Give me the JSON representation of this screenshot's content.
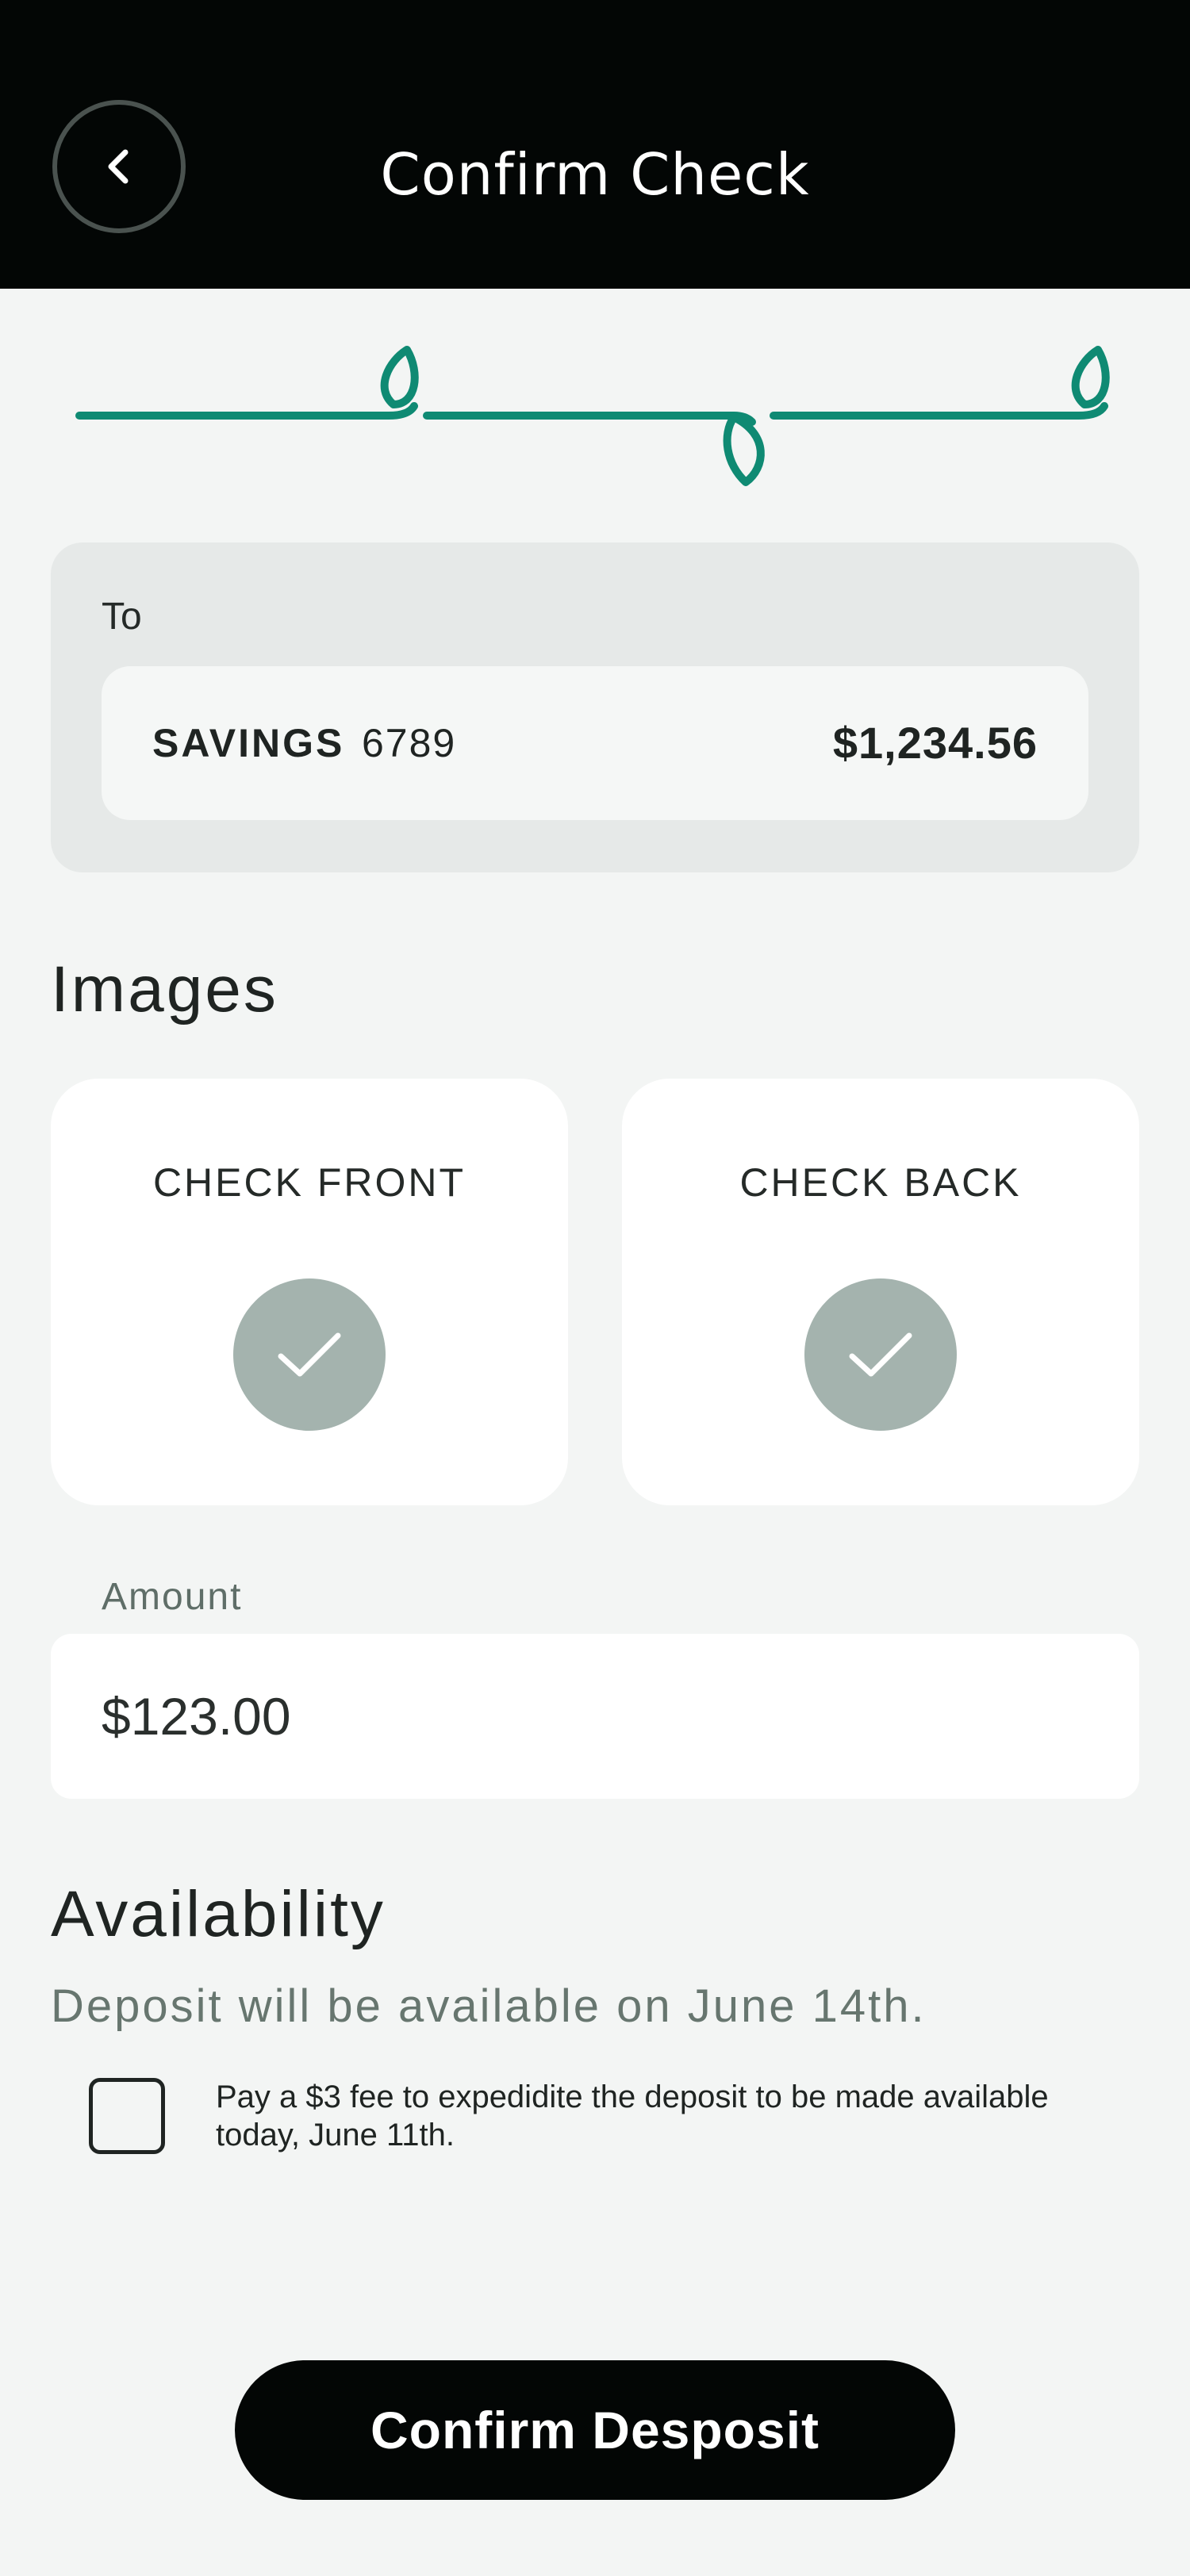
{
  "header": {
    "title": "Confirm Check",
    "back_icon": "chevron-left-icon"
  },
  "stepper": {
    "steps": 3,
    "accent_color": "#0f8a73"
  },
  "to_section": {
    "label": "To",
    "account": {
      "type": "SAVINGS",
      "number": "6789",
      "balance": "$1,234.56"
    }
  },
  "images_section": {
    "title": "Images",
    "cards": [
      {
        "label": "CHECK FRONT",
        "status_icon": "checkmark-icon"
      },
      {
        "label": "CHECK BACK",
        "status_icon": "checkmark-icon"
      }
    ]
  },
  "amount": {
    "label": "Amount",
    "value": "$123.00"
  },
  "availability": {
    "title": "Availability",
    "note": "Deposit will be available on June 14th.",
    "fee_option": {
      "checked": false,
      "text": "Pay a $3 fee to expedidite the deposit to be made available today, June 11th."
    }
  },
  "footer": {
    "confirm_label": "Confirm Desposit"
  },
  "colors": {
    "header_bg": "#030605",
    "page_bg": "#f3f5f4",
    "accent": "#0f8a73",
    "check_circle": "#a4b3ae"
  }
}
